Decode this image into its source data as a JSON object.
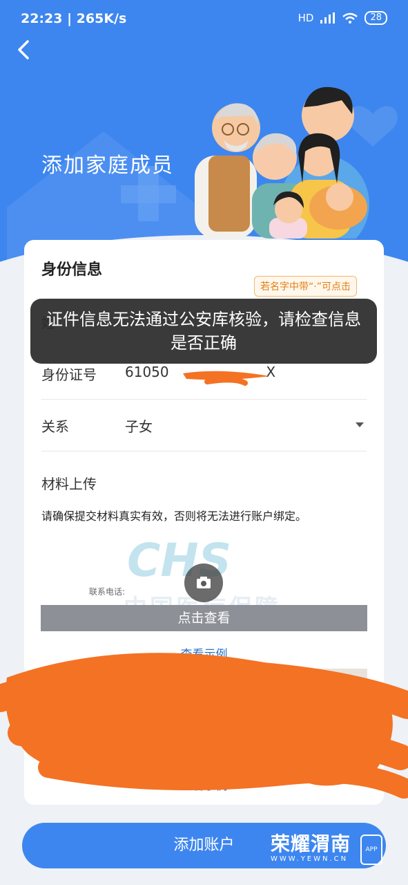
{
  "status_bar": {
    "time": "22:23",
    "speed": "265K/s",
    "network": "HD",
    "battery": "28"
  },
  "page": {
    "title": "添加家庭成员"
  },
  "form": {
    "section_title": "身份信息",
    "name_hint": "若名字中带“·”可点击",
    "name_label": "姓",
    "id_label": "身份证号",
    "id_value": "61050",
    "id_suffix": "X",
    "relation_label": "关系",
    "relation_value": "子女",
    "upload_title": "材料上传",
    "upload_note": "请确保提交材料真实有效，否则将无法进行账户绑定。",
    "sample_phone_label": "联系电话:",
    "sample_logo": "CHS",
    "sample_org": "中国医疗保障",
    "view_label": "点击查看",
    "example_link": "查看示例",
    "example_link_2": "查看示例"
  },
  "toast": {
    "message": "证件信息无法通过公安库核验，请检查信息是否正确"
  },
  "footer": {
    "add_button": "添加账户"
  },
  "watermark": {
    "title": "荣耀渭南",
    "url": "WWW.YEWN.CN",
    "badge": "APP"
  },
  "colors": {
    "primary": "#3d86ef",
    "link": "#2a73c6",
    "hint": "#e07f12",
    "scribble": "#f47224"
  }
}
